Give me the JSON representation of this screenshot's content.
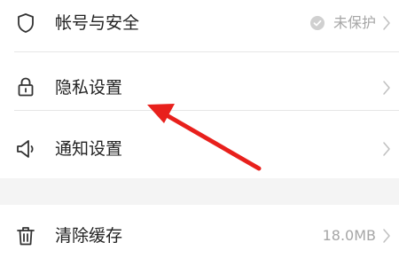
{
  "settings": {
    "group1": [
      {
        "label": "帐号与安全",
        "status": "未保护",
        "icon": "shield-icon"
      },
      {
        "label": "隐私设置",
        "icon": "lock-icon"
      },
      {
        "label": "通知设置",
        "icon": "speaker-icon"
      }
    ],
    "group2": [
      {
        "label": "清除缓存",
        "value": "18.0MB",
        "icon": "trash-icon"
      }
    ]
  },
  "colors": {
    "annotation_arrow": "#e8201c",
    "divider": "#e6e6e6",
    "section_gap": "#f4f4f4",
    "secondary_text": "#a6a6a6"
  }
}
